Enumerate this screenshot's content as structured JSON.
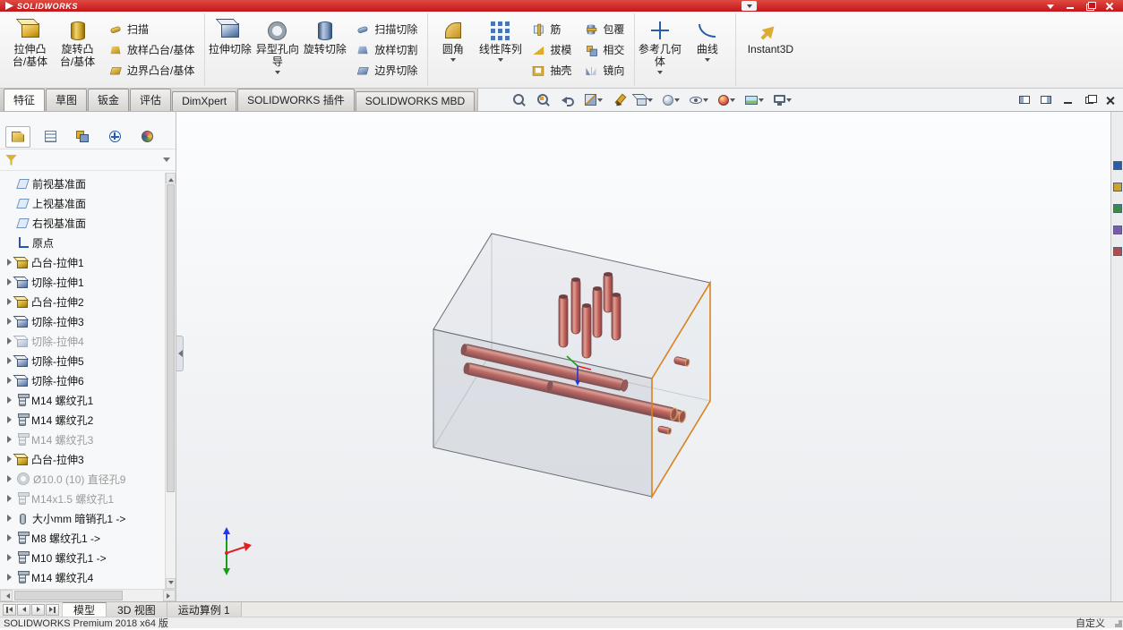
{
  "colors": {
    "titlebar-red": "#c4161c",
    "edge-orange": "#d9831f",
    "pipe-red": "#b02a22",
    "axis-x": "#e02020",
    "axis-y": "#16a016",
    "axis-z": "#2238d8",
    "suppressed-gray": "#9b9b9b"
  },
  "titlebar": {
    "brand": "SOLIDWORKS"
  },
  "ribbon": {
    "extrude_boss": "拉伸凸台/基体",
    "revolve_boss": "旋转凸台/基体",
    "swept_boss": "扫描",
    "lofted_boss": "放样凸台/基体",
    "boundary_boss": "边界凸台/基体",
    "extruded_cut": "拉伸切除",
    "hole_wizard": "异型孔向导",
    "revolved_cut": "旋转切除",
    "swept_cut": "扫描切除",
    "lofted_cut": "放样切割",
    "boundary_cut": "边界切除",
    "fillet": "圆角",
    "linear_pattern": "线性阵列",
    "rib": "筋",
    "draft": "拔模",
    "shell": "抽壳",
    "wrap": "包覆",
    "intersect": "相交",
    "mirror": "镜向",
    "reference_geometry": "参考几何体",
    "curves": "曲线",
    "instant3d": "Instant3D"
  },
  "tabs": {
    "items": [
      {
        "label": "特征",
        "state": "active"
      },
      {
        "label": "草图",
        "state": ""
      },
      {
        "label": "钣金",
        "state": ""
      },
      {
        "label": "评估",
        "state": ""
      },
      {
        "label": "DimXpert",
        "state": ""
      },
      {
        "label": "SOLIDWORKS 插件",
        "state": ""
      },
      {
        "label": "SOLIDWORKS MBD",
        "state": ""
      }
    ]
  },
  "hud": {
    "items": [
      {
        "name": "zoom-fit-icon",
        "caret": ""
      },
      {
        "name": "zoom-area-icon",
        "caret": ""
      },
      {
        "name": "previous-view-icon",
        "caret": ""
      },
      {
        "name": "section-view-icon",
        "caret": "dn"
      },
      {
        "name": "annotation-view-icon",
        "caret": ""
      },
      {
        "name": "view-orientation-icon",
        "caret": "dn"
      },
      {
        "name": "display-style-icon",
        "caret": "dn"
      },
      {
        "name": "hide-show-items-icon",
        "caret": "dn"
      },
      {
        "name": "edit-appearance-icon",
        "caret": "dn"
      },
      {
        "name": "apply-scene-icon",
        "caret": "dn"
      },
      {
        "name": "view-settings-icon",
        "caret": "dn"
      }
    ]
  },
  "manager_tabs": {
    "items": [
      {
        "name": "feature-manager-icon",
        "state": "active"
      },
      {
        "name": "property-manager-icon",
        "state": ""
      },
      {
        "name": "configuration-manager-icon",
        "state": ""
      },
      {
        "name": "dimxpert-manager-icon",
        "state": ""
      },
      {
        "name": "display-manager-icon",
        "state": ""
      }
    ]
  },
  "tree": {
    "items": [
      {
        "label": "前视基准面",
        "icon": "plane-icon",
        "expandable": "",
        "state": ""
      },
      {
        "label": "上视基准面",
        "icon": "plane-icon",
        "expandable": "",
        "state": ""
      },
      {
        "label": "右视基准面",
        "icon": "plane-icon",
        "expandable": "",
        "state": ""
      },
      {
        "label": "原点",
        "icon": "origin-icon",
        "expandable": "",
        "state": ""
      },
      {
        "label": "凸台-拉伸1",
        "icon": "boss-extrude-icon",
        "expandable": "exp",
        "state": ""
      },
      {
        "label": "切除-拉伸1",
        "icon": "cut-extrude-icon",
        "expandable": "exp",
        "state": ""
      },
      {
        "label": "凸台-拉伸2",
        "icon": "boss-extrude-icon",
        "expandable": "exp",
        "state": ""
      },
      {
        "label": "切除-拉伸3",
        "icon": "cut-extrude-icon",
        "expandable": "exp",
        "state": ""
      },
      {
        "label": "切除-拉伸4",
        "icon": "cut-extrude-icon",
        "expandable": "exp",
        "state": "suppressed"
      },
      {
        "label": "切除-拉伸5",
        "icon": "cut-extrude-icon",
        "expandable": "exp",
        "state": ""
      },
      {
        "label": "切除-拉伸6",
        "icon": "cut-extrude-icon",
        "expandable": "exp",
        "state": ""
      },
      {
        "label": "M14 螺纹孔1",
        "icon": "thread-hole-icon",
        "expandable": "exp",
        "state": ""
      },
      {
        "label": "M14 螺纹孔2",
        "icon": "thread-hole-icon",
        "expandable": "exp",
        "state": ""
      },
      {
        "label": "M14 螺纹孔3",
        "icon": "thread-hole-icon",
        "expandable": "exp",
        "state": "suppressed"
      },
      {
        "label": "凸台-拉伸3",
        "icon": "boss-extrude-icon",
        "expandable": "exp",
        "state": ""
      },
      {
        "label": "Ø10.0 (10) 直径孔9",
        "icon": "simple-hole-icon",
        "expandable": "exp",
        "state": "suppressed"
      },
      {
        "label": "M14x1.5 螺纹孔1",
        "icon": "thread-hole-icon",
        "expandable": "exp",
        "state": "suppressed"
      },
      {
        "label": "大小mm 暗销孔1 ->",
        "icon": "dowel-hole-icon",
        "expandable": "exp",
        "state": ""
      },
      {
        "label": "M8 螺纹孔1 ->",
        "icon": "thread-hole-icon",
        "expandable": "exp",
        "state": ""
      },
      {
        "label": "M10 螺纹孔1 ->",
        "icon": "thread-hole-icon",
        "expandable": "exp",
        "state": ""
      },
      {
        "label": "M14 螺纹孔4",
        "icon": "thread-hole-icon",
        "expandable": "exp",
        "state": ""
      }
    ]
  },
  "taskpane": {
    "items": [
      {
        "name": "resources-icon"
      },
      {
        "name": "design-library-icon"
      },
      {
        "name": "file-explorer-icon"
      },
      {
        "name": "view-palette-icon"
      },
      {
        "name": "appearances-icon"
      }
    ]
  },
  "bottom_tabs": {
    "items": [
      {
        "label": "模型",
        "state": "active"
      },
      {
        "label": "3D 视图",
        "state": ""
      },
      {
        "label": "运动算例 1",
        "state": ""
      }
    ]
  },
  "statusbar": {
    "left": "SOLIDWORKS Premium 2018 x64 版",
    "right": "自定义"
  }
}
